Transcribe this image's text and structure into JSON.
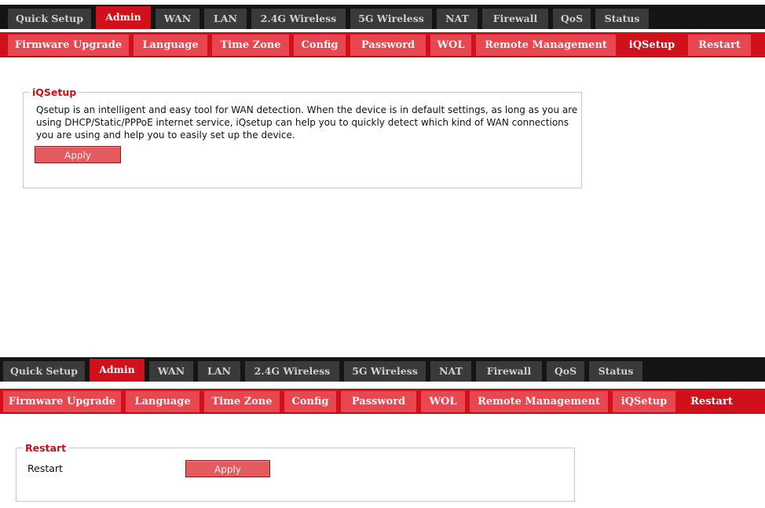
{
  "screens": [
    {
      "top_tabs": [
        "Quick Setup",
        "Admin",
        "WAN",
        "LAN",
        "2.4G Wireless",
        "5G Wireless",
        "NAT",
        "Firewall",
        "QoS",
        "Status"
      ],
      "top_active": "Admin",
      "sub_tabs": [
        "Firmware Upgrade",
        "Language",
        "Time Zone",
        "Config",
        "Password",
        "WOL",
        "Remote Management",
        "iQSetup",
        "Restart"
      ],
      "sub_active": "iQSetup",
      "panel": {
        "legend": "iQSetup",
        "description_lines": [
          "Qsetup is an intelligent and easy tool for WAN detection. When the device is in default settings, as long as you are",
          "using DHCP/Static/PPPoE internet service, iQsetup can help you to quickly detect which kind of WAN connections",
          "you are using and help you to easily set up the device."
        ],
        "apply_label": "Apply"
      }
    },
    {
      "top_tabs": [
        "Quick Setup",
        "Admin",
        "WAN",
        "LAN",
        "2.4G Wireless",
        "5G Wireless",
        "NAT",
        "Firewall",
        "QoS",
        "Status"
      ],
      "top_active": "Admin",
      "sub_tabs": [
        "Firmware Upgrade",
        "Language",
        "Time Zone",
        "Config",
        "Password",
        "WOL",
        "Remote Management",
        "iQSetup",
        "Restart"
      ],
      "sub_active": "Restart",
      "panel": {
        "legend": "Restart",
        "field_label": "Restart",
        "apply_label": "Apply"
      }
    }
  ],
  "colors": {
    "top_bar": "#141414",
    "top_tab": "#3a3a3a",
    "accent_red": "#d0101a",
    "sub_tab": "#e8474f",
    "button": "#e35a5f"
  }
}
